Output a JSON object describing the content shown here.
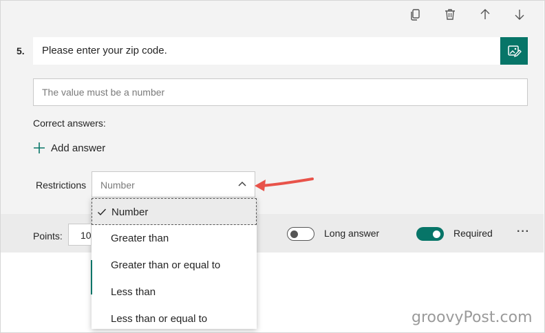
{
  "question": {
    "number": "5.",
    "title": "Please enter your zip code.",
    "answer_placeholder": "The value must be a number"
  },
  "correct_answers": {
    "label": "Correct answers:",
    "add_answer_label": "Add answer"
  },
  "restrictions": {
    "label": "Restrictions",
    "selected": "Number",
    "options": [
      "Number",
      "Greater than",
      "Greater than or equal to",
      "Less than",
      "Less than or equal to"
    ]
  },
  "footer": {
    "points_label": "Points:",
    "points_value": "10",
    "long_answer_label": "Long answer",
    "long_answer_on": false,
    "required_label": "Required",
    "required_on": true,
    "more_label": "···"
  },
  "toolbar": {
    "icons": [
      "copy-icon",
      "trash-icon",
      "arrow-up-icon",
      "arrow-down-icon"
    ]
  },
  "colors": {
    "accent": "#077568",
    "annotation_arrow": "#e8534a"
  },
  "watermark": "groovyPost.com"
}
